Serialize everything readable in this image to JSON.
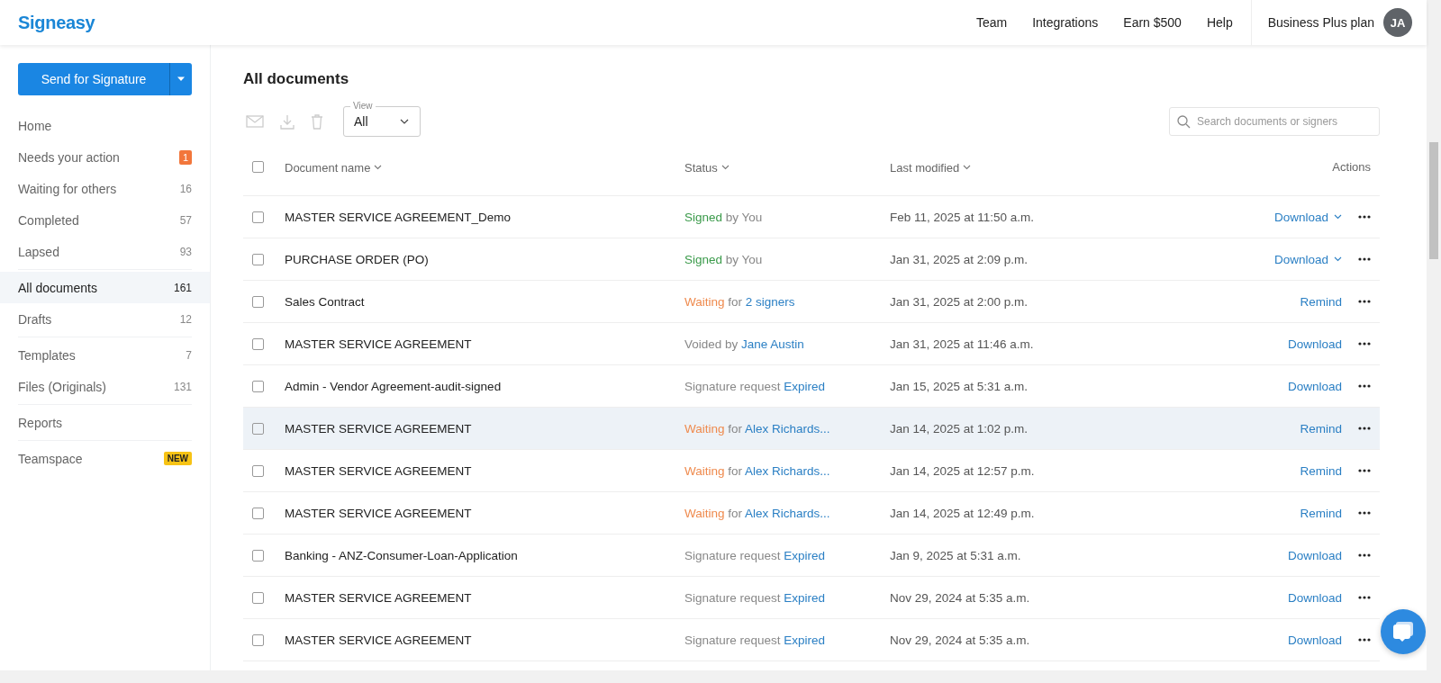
{
  "header": {
    "logo": "Signeasy",
    "nav": [
      "Team",
      "Integrations",
      "Earn $500",
      "Help"
    ],
    "plan": "Business Plus plan",
    "avatar": "JA"
  },
  "sidebar": {
    "primary_button": "Send for Signature",
    "groups": [
      [
        {
          "label": "Home",
          "selected": false
        },
        {
          "label": "Needs your action",
          "selected": false,
          "badge": {
            "kind": "alert",
            "text": "1"
          }
        },
        {
          "label": "Waiting for others",
          "selected": false,
          "badge": {
            "kind": "count",
            "text": "16"
          }
        },
        {
          "label": "Completed",
          "selected": false,
          "badge": {
            "kind": "count",
            "text": "57"
          }
        },
        {
          "label": "Lapsed",
          "selected": false,
          "badge": {
            "kind": "count",
            "text": "93"
          }
        }
      ],
      [
        {
          "label": "All documents",
          "selected": true,
          "badge": {
            "kind": "count",
            "text": "161"
          }
        },
        {
          "label": "Drafts",
          "selected": false,
          "badge": {
            "kind": "count",
            "text": "12"
          }
        }
      ],
      [
        {
          "label": "Templates",
          "selected": false,
          "badge": {
            "kind": "count",
            "text": "7"
          }
        },
        {
          "label": "Files (Originals)",
          "selected": false,
          "badge": {
            "kind": "count",
            "text": "131"
          }
        }
      ],
      [
        {
          "label": "Reports",
          "selected": false
        }
      ],
      [
        {
          "label": "Teamspace",
          "selected": false,
          "badge": {
            "kind": "new",
            "text": "NEW"
          }
        }
      ]
    ]
  },
  "main": {
    "title": "All documents",
    "view": {
      "label": "View",
      "value": "All"
    },
    "search": {
      "placeholder": "Search documents or signers"
    },
    "select_all_checked": false,
    "columns": [
      "Document name",
      "Status",
      "Last modified",
      "Actions"
    ],
    "rows": [
      {
        "name": "MASTER SERVICE AGREEMENT_Demo",
        "status": [
          {
            "kind": "green",
            "text": "Signed"
          },
          {
            "kind": "plain",
            "text": "by You"
          }
        ],
        "modified": "Feb 11, 2025 at 11:50 a.m.",
        "action": "Download",
        "action_menu": true,
        "highlighted": false
      },
      {
        "name": "PURCHASE ORDER (PO)",
        "status": [
          {
            "kind": "green",
            "text": "Signed"
          },
          {
            "kind": "plain",
            "text": "by You"
          }
        ],
        "modified": "Jan 31, 2025 at 2:09 p.m.",
        "action": "Download",
        "action_menu": true,
        "highlighted": false
      },
      {
        "name": "Sales Contract",
        "status": [
          {
            "kind": "orange",
            "text": "Waiting"
          },
          {
            "kind": "plain",
            "text": "for"
          },
          {
            "kind": "link",
            "text": "2 signers"
          }
        ],
        "modified": "Jan 31, 2025 at 2:00 p.m.",
        "action": "Remind",
        "action_menu": false,
        "highlighted": false
      },
      {
        "name": "MASTER SERVICE AGREEMENT",
        "status": [
          {
            "kind": "plain",
            "text": "Voided by"
          },
          {
            "kind": "link",
            "text": "Jane Austin"
          }
        ],
        "modified": "Jan 31, 2025 at 11:46 a.m.",
        "action": "Download",
        "action_menu": false,
        "highlighted": false
      },
      {
        "name": "Admin - Vendor Agreement-audit-signed",
        "status": [
          {
            "kind": "plain",
            "text": "Signature request"
          },
          {
            "kind": "link",
            "text": "Expired"
          }
        ],
        "modified": "Jan 15, 2025 at 5:31 a.m.",
        "action": "Download",
        "action_menu": false,
        "highlighted": false
      },
      {
        "name": "MASTER SERVICE AGREEMENT",
        "status": [
          {
            "kind": "orange",
            "text": "Waiting"
          },
          {
            "kind": "plain",
            "text": "for"
          },
          {
            "kind": "link",
            "text": "Alex Richards..."
          }
        ],
        "modified": "Jan 14, 2025 at 1:02 p.m.",
        "action": "Remind",
        "action_menu": false,
        "highlighted": true
      },
      {
        "name": "MASTER SERVICE AGREEMENT",
        "status": [
          {
            "kind": "orange",
            "text": "Waiting"
          },
          {
            "kind": "plain",
            "text": "for"
          },
          {
            "kind": "link",
            "text": "Alex Richards..."
          }
        ],
        "modified": "Jan 14, 2025 at 12:57 p.m.",
        "action": "Remind",
        "action_menu": false,
        "highlighted": false
      },
      {
        "name": "MASTER SERVICE AGREEMENT",
        "status": [
          {
            "kind": "orange",
            "text": "Waiting"
          },
          {
            "kind": "plain",
            "text": "for"
          },
          {
            "kind": "link",
            "text": "Alex Richards..."
          }
        ],
        "modified": "Jan 14, 2025 at 12:49 p.m.",
        "action": "Remind",
        "action_menu": false,
        "highlighted": false
      },
      {
        "name": "Banking - ANZ-Consumer-Loan-Application",
        "status": [
          {
            "kind": "plain",
            "text": "Signature request"
          },
          {
            "kind": "link",
            "text": "Expired"
          }
        ],
        "modified": "Jan 9, 2025 at 5:31 a.m.",
        "action": "Download",
        "action_menu": false,
        "highlighted": false
      },
      {
        "name": "MASTER SERVICE AGREEMENT",
        "status": [
          {
            "kind": "plain",
            "text": "Signature request"
          },
          {
            "kind": "link",
            "text": "Expired"
          }
        ],
        "modified": "Nov 29, 2024 at 5:35 a.m.",
        "action": "Download",
        "action_menu": false,
        "highlighted": false
      },
      {
        "name": "MASTER SERVICE AGREEMENT",
        "status": [
          {
            "kind": "plain",
            "text": "Signature request"
          },
          {
            "kind": "link",
            "text": "Expired"
          }
        ],
        "modified": "Nov 29, 2024 at 5:35 a.m.",
        "action": "Download",
        "action_menu": false,
        "highlighted": false
      }
    ]
  }
}
